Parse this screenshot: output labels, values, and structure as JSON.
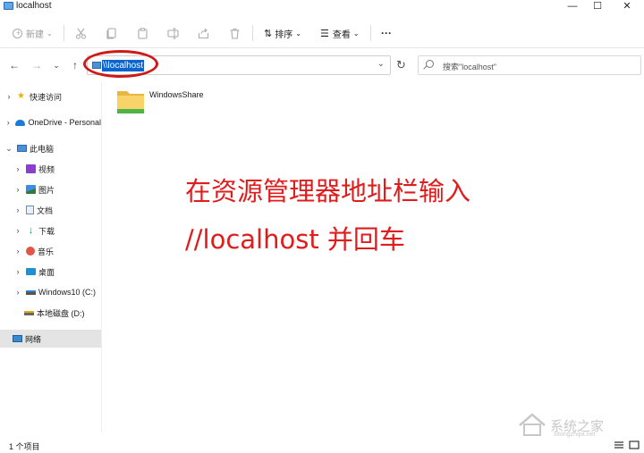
{
  "window": {
    "title": "localhost",
    "controls": {
      "minimize": "—",
      "maximize": "☐",
      "close": "✕"
    }
  },
  "toolbar": {
    "new_label": "新建",
    "sort_label": "排序",
    "view_label": "查看",
    "more": "···"
  },
  "nav": {
    "back": "←",
    "forward": "→",
    "recent": "⌄",
    "up": "↑"
  },
  "address": {
    "path": "\\\\localhost",
    "dropdown": "⌄",
    "refresh": "↻"
  },
  "search": {
    "placeholder": "搜索\"localhost\""
  },
  "sidebar": {
    "items": [
      {
        "label": "快速访问",
        "icon": "star-icon"
      },
      {
        "label": "OneDrive - Personal",
        "icon": "cloud-icon"
      },
      {
        "label": "此电脑",
        "icon": "pc-icon"
      },
      {
        "label": "视频",
        "icon": "video-icon"
      },
      {
        "label": "图片",
        "icon": "pictures-icon"
      },
      {
        "label": "文档",
        "icon": "document-icon"
      },
      {
        "label": "下载",
        "icon": "download-icon"
      },
      {
        "label": "音乐",
        "icon": "music-icon"
      },
      {
        "label": "桌面",
        "icon": "desktop-icon"
      },
      {
        "label": "Windows10 (C:)",
        "icon": "drive-icon"
      },
      {
        "label": "本地磁盘 (D:)",
        "icon": "drive-icon"
      },
      {
        "label": "网络",
        "icon": "network-icon"
      }
    ]
  },
  "content": {
    "items": [
      {
        "name": "WindowsShare",
        "icon": "shared-folder-icon"
      }
    ]
  },
  "annotation": {
    "line1": "在资源管理器地址栏输入",
    "line2": "//localhost    并回车",
    "color": "#e11c1c"
  },
  "status": {
    "count": "1 个项目"
  },
  "watermark": {
    "text": "系统之家",
    "url": "xitongzhijia.net"
  },
  "colors": {
    "accent": "#0a64d0",
    "highlight_ring": "#d01818",
    "selected_bg": "#e4e4e4"
  }
}
